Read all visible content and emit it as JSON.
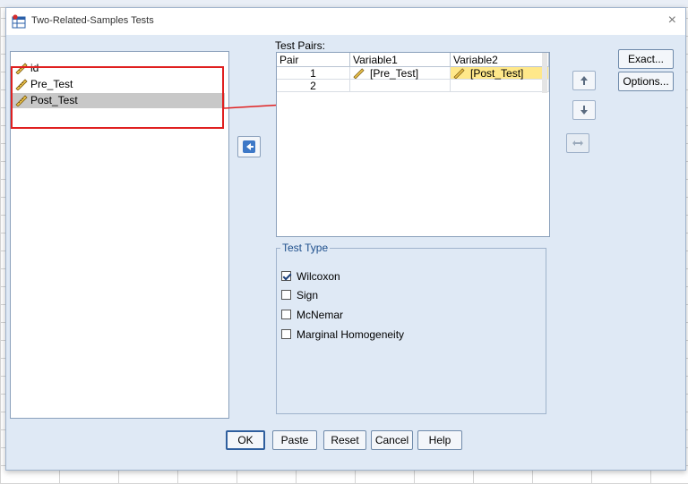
{
  "dialog": {
    "title": "Two-Related-Samples Tests",
    "close_glyph": "×",
    "title_icon": "spss-table-icon"
  },
  "variables": [
    {
      "name": "id",
      "icon": "ruler-icon"
    },
    {
      "name": "Pre_Test",
      "icon": "ruler-icon"
    },
    {
      "name": "Post_Test",
      "icon": "ruler-icon",
      "selected": true
    }
  ],
  "test_pairs": {
    "label": "Test Pairs:",
    "columns": [
      "Pair",
      "Variable1",
      "Variable2"
    ],
    "rows": [
      {
        "pair": "1",
        "variable1": "[Pre_Test]",
        "variable2": "[Post_Test]"
      },
      {
        "pair": "2",
        "variable1": "",
        "variable2": ""
      }
    ]
  },
  "side_buttons": {
    "up": "up-arrow-icon",
    "down": "down-arrow-icon",
    "swap": "swap-arrow-icon"
  },
  "right_buttons": {
    "exact": "Exact...",
    "options": "Options..."
  },
  "test_type": {
    "legend": "Test Type",
    "options": [
      {
        "label": "Wilcoxon",
        "checked": true
      },
      {
        "label": "Sign",
        "checked": false
      },
      {
        "label": "McNemar",
        "checked": false
      },
      {
        "label": "Marginal Homogeneity",
        "checked": false
      }
    ]
  },
  "buttons": {
    "ok": "OK",
    "paste": "Paste",
    "reset": "Reset",
    "cancel": "Cancel",
    "help": "Help"
  },
  "colors": {
    "annotation_red": "#e02020",
    "selected_cell": "#ffe88a",
    "dialog_bg": "#dfe9f5"
  }
}
